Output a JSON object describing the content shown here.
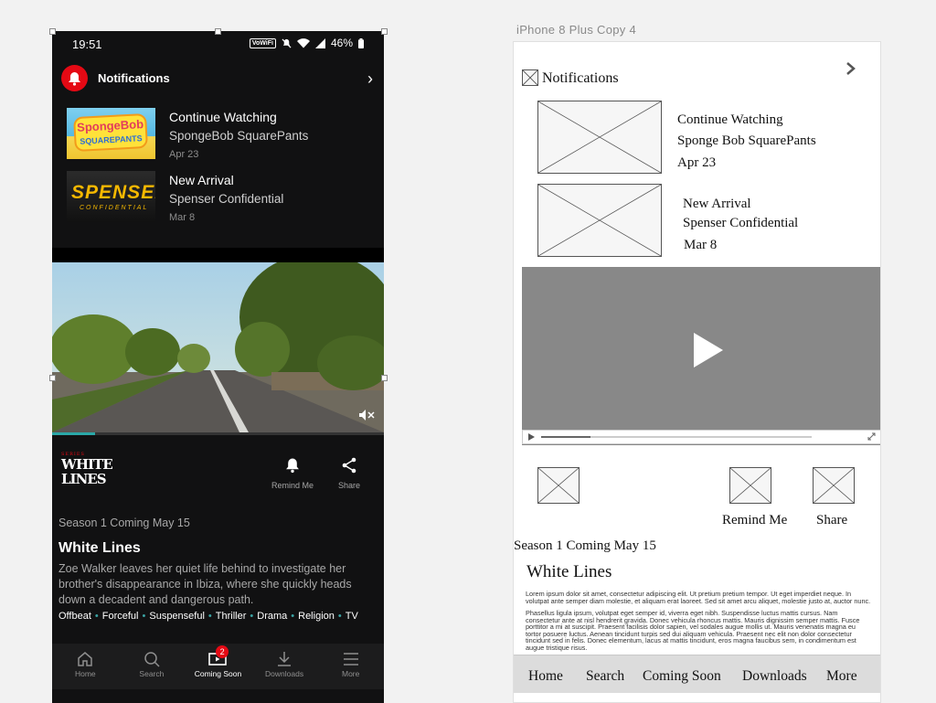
{
  "phone": {
    "status": {
      "time": "19:51",
      "vowifi": "VoWiFi",
      "battery": "46%"
    },
    "notifications": {
      "title": "Notifications",
      "items": [
        {
          "line1": "Continue Watching",
          "line2": "SpongeBob SquarePants",
          "line3": "Apr 23",
          "thumb_text_1": "SpongeBob",
          "thumb_text_2": "SQUAREPANTS"
        },
        {
          "line1": "New Arrival",
          "line2": "Spenser Confidential",
          "line3": "Mar 8",
          "thumb_text_1": "SPENSER",
          "thumb_text_2": "CONFIDENTIAL"
        }
      ]
    },
    "video": {
      "progress": 0.13
    },
    "show": {
      "logo_top": "SERIES",
      "logo_line1": "WHITE",
      "logo_line2": "LINES",
      "remind_label": "Remind Me",
      "share_label": "Share",
      "coming": "Season 1 Coming May 15",
      "title": "White Lines",
      "synopsis": "Zoe Walker leaves her quiet life behind to investigate her brother's disappearance in Ibiza, where she quickly heads down a decadent and dangerous path.",
      "tags": [
        "Offbeat",
        "Forceful",
        "Suspenseful",
        "Thriller",
        "Drama",
        "Religion",
        "TV"
      ]
    },
    "nav": {
      "home": "Home",
      "search": "Search",
      "coming_soon": "Coming Soon",
      "coming_badge": "2",
      "downloads": "Downloads",
      "more": "More"
    },
    "colors": {
      "accent": "#e50914",
      "progress": "#2aa7a7",
      "background": "#111112"
    }
  },
  "wireframe": {
    "artboard_label": "iPhone 8 Plus Copy 4",
    "notifications_title": "Notifications",
    "item1": {
      "line1": "Continue Watching",
      "line2": "Sponge Bob SquarePants",
      "line3": "Apr 23"
    },
    "item2": {
      "line1": "New Arrival",
      "line2": "Spenser Confidential",
      "line3": "Mar 8"
    },
    "remind_label": "Remind Me",
    "share_label": "Share",
    "coming": "Season 1 Coming May 15",
    "title": "White Lines",
    "lorem_1": "Lorem ipsum dolor sit amet, consectetur adipiscing elit. Ut pretium pretium tempor. Ut eget imperdiet neque. In volutpat ante semper diam molestie, et aliquam erat laoreet. Sed sit amet arcu aliquet, molestie justo at, auctor nunc.",
    "lorem_2": "Phasellus ligula ipsum, volutpat eget semper id, viverra eget nibh. Suspendisse luctus mattis cursus. Nam consectetur ante at nisl hendrerit gravida. Donec vehicula rhoncus mattis. Mauris dignissim semper mattis. Fusce porttitor a mi at suscipit. Praesent facilisis dolor sapien, vel sodales augue mollis ut. Mauris venenatis magna eu tortor posuere luctus. Aenean tincidunt turpis sed dui aliquam vehicula. Praesent nec elit non dolor consectetur tincidunt sed in felis. Donec elementum, lacus at mattis tincidunt, eros magna faucibus sem, in condimentum est augue tristique risus.",
    "nav": [
      "Home",
      "Search",
      "Coming Soon",
      "Downloads",
      "More"
    ]
  }
}
